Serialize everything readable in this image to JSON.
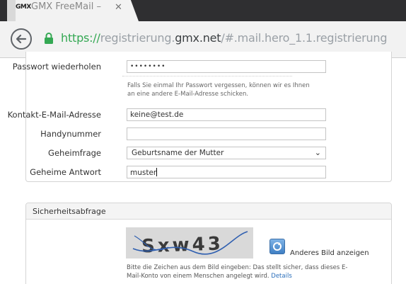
{
  "browser": {
    "favicon_text": "GMX",
    "tab_title": "GMX FreeMail – ",
    "tab_close": "✕",
    "url_scheme": "https://",
    "url_sub": "registrierung.",
    "url_host": "gmx.net",
    "url_path": "/#.mail.hero_1.1.registrierung"
  },
  "form": {
    "password_repeat": {
      "label": "Passwort wiederholen",
      "value": "••••••••"
    },
    "hint": "Falls Sie einmal Ihr Passwort vergessen, können wir es Ihnen an eine andere E-Mail-Adresse schicken.",
    "contact_email": {
      "label": "Kontakt-E-Mail-Adresse",
      "value": "keine@test.de"
    },
    "mobile": {
      "label": "Handynummer",
      "value": ""
    },
    "security_question": {
      "label": "Geheimfrage",
      "value": "Geburtsname der Mutter"
    },
    "secret_answer": {
      "label": "Geheime Antwort",
      "value": "muster"
    }
  },
  "captcha_section": {
    "title": "Sicherheitsabfrage",
    "captcha_text": "Sxw43",
    "refresh_label": "Anderes Bild anzeigen",
    "hint": "Bitte die Zeichen aus dem Bild eingeben: Das stellt sicher, dass dieses E-Mail-Konto von einem Menschen angelegt wird.",
    "details_link": "Details"
  },
  "colors": {
    "chrome_dark": "#2f2f31",
    "secure_green": "#34a853",
    "link_blue": "#2a6ebb"
  },
  "icons": [
    "back-arrow-icon",
    "lock-icon",
    "close-icon",
    "chevron-down-icon",
    "refresh-icon"
  ]
}
